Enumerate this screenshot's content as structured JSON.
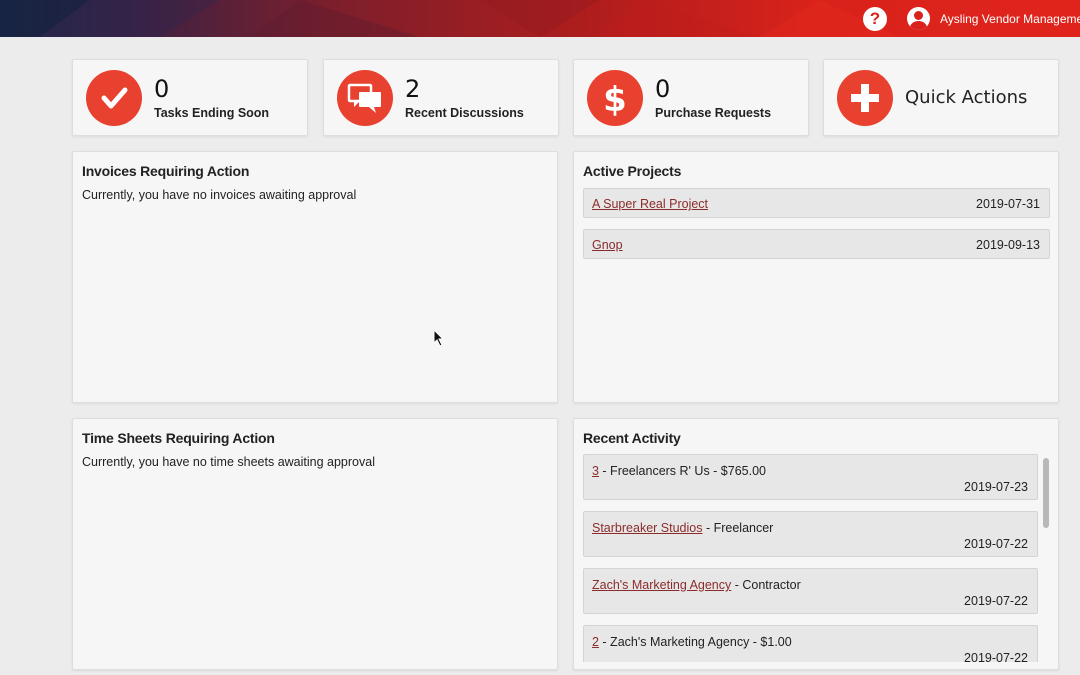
{
  "header": {
    "help_icon": "question-circle-icon",
    "help_label": "?",
    "user_icon": "user-circle-icon",
    "user_name": "Aysling Vendor Management"
  },
  "stats": [
    {
      "icon": "checkmark-icon",
      "value": "0",
      "label": "Tasks Ending Soon"
    },
    {
      "icon": "chat-bubbles-icon",
      "value": "2",
      "label": "Recent Discussions"
    },
    {
      "icon": "dollar-icon",
      "value": "0",
      "label": "Purchase Requests"
    }
  ],
  "quick_actions": {
    "icon": "plus-icon",
    "label": "Quick Actions"
  },
  "invoices": {
    "title": "Invoices Requiring Action",
    "message": "Currently, you have no invoices awaiting approval"
  },
  "active_projects": {
    "title": "Active Projects",
    "items": [
      {
        "name": "A Super Real Project",
        "date": "2019-07-31"
      },
      {
        "name": "Gnop",
        "date": "2019-09-13"
      }
    ]
  },
  "time_sheets": {
    "title": "Time Sheets Requiring Action",
    "message": "Currently, you have no time sheets awaiting approval"
  },
  "recent_activity": {
    "title": "Recent Activity",
    "items": [
      {
        "link": "3",
        "rest": " - Freelancers R' Us - $765.00",
        "date": "2019-07-23"
      },
      {
        "link": "Starbreaker Studios",
        "rest": " - Freelancer",
        "date": "2019-07-22"
      },
      {
        "link": "Zach's Marketing Agency",
        "rest": " - Contractor",
        "date": "2019-07-22"
      },
      {
        "link": "2",
        "rest": " - Zach's Marketing Agency - $1.00",
        "date": "2019-07-22"
      }
    ]
  },
  "colors": {
    "accent": "#e8412f",
    "link": "#8b2c2c",
    "header_start": "#1d2a4a",
    "header_end": "#e0241c"
  }
}
